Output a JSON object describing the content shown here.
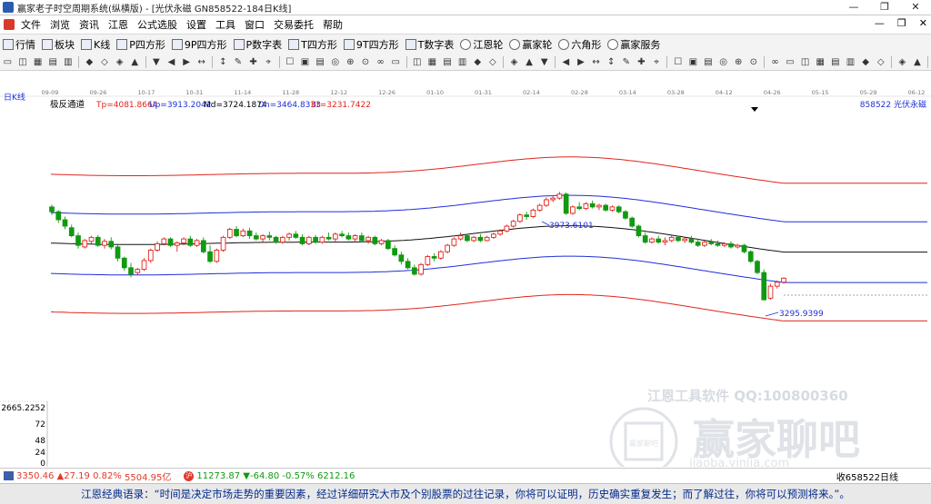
{
  "window": {
    "title": "赢家老子时空周期系统(纵横版) - [光伏永磁  GN858522-184日K线]",
    "controls": [
      "—",
      "❐",
      "✕"
    ]
  },
  "menu": {
    "items": [
      "文件",
      "浏览",
      "资讯",
      "江恩",
      "公式选股",
      "设置",
      "工具",
      "窗口",
      "交易委托",
      "帮助"
    ],
    "right": [
      "—",
      "❐",
      "✕"
    ]
  },
  "toolbar1": {
    "items": [
      {
        "label": "行情",
        "icon": "grid-icon"
      },
      {
        "label": "板块",
        "icon": "grid-icon"
      },
      {
        "label": "K线",
        "icon": "candlestick-icon"
      },
      {
        "label": "P四方形",
        "icon": "square-p-icon"
      },
      {
        "label": "9P四方形",
        "icon": "square-9p-icon"
      },
      {
        "label": "P数字表",
        "icon": "table-p-icon"
      },
      {
        "label": "T四方形",
        "icon": "square-t-icon"
      },
      {
        "label": "9T四方形",
        "icon": "square-9t-icon"
      },
      {
        "label": "T数字表",
        "icon": "table-t-icon"
      },
      {
        "label": "江恩轮",
        "icon": "wheel-icon"
      },
      {
        "label": "赢家轮",
        "icon": "wheel-icon"
      },
      {
        "label": "六角形",
        "icon": "hexagon-icon"
      },
      {
        "label": "赢家服务",
        "icon": "dollar-icon"
      }
    ]
  },
  "toolbar2": {
    "groups": [
      5,
      4,
      4,
      4,
      8,
      6,
      3,
      7,
      6,
      8,
      2
    ]
  },
  "chart": {
    "period_label": "日K线",
    "indicator_name": "极反通道",
    "tp_text": "Tp=4081.8664",
    "up_text": "Up=3913.2042",
    "md_text": "Md=3724.1874",
    "dn_text": "Dn=3464.8333",
    "bt_text": "Bt=3231.7422",
    "symbol_text": "858522  光伏永磁",
    "high_annotation": "3973.6101",
    "low_annotation": "3295.9399",
    "dates": [
      "09-09",
      "09-26",
      "10-17",
      "10-31",
      "11-14",
      "11-28",
      "12-12",
      "12-26",
      "01-10",
      "01-31",
      "02-14",
      "02-28",
      "03-14",
      "03-28",
      "04-12",
      "04-26",
      "05-15",
      "05-29",
      "06-12"
    ],
    "price_label": "2665.2252",
    "volume_labels": [
      "72",
      "48",
      "24",
      "0"
    ]
  },
  "chart_data": {
    "type": "candlestick",
    "title": "光伏永磁 858522 日K线",
    "indicator": "极反通道",
    "price_range": [
      2665.2252,
      4560
    ],
    "x_ticks": [
      "09-09",
      "09-26",
      "10-17",
      "10-31",
      "11-14",
      "11-28",
      "12-12",
      "12-26",
      "01-10",
      "01-31",
      "02-14",
      "02-28",
      "03-14",
      "03-28",
      "04-12",
      "04-26",
      "05-15",
      "05-29",
      "06-12"
    ],
    "channel_last_values": {
      "Tp": 4081.8664,
      "Up": 3913.2042,
      "Md": 3724.1874,
      "Dn": 3464.8333,
      "Bt": 3231.7422
    },
    "annotations": {
      "high": 3973.6101,
      "low": 3295.9399
    },
    "candles": [
      {
        "o": 3880,
        "h": 3895,
        "c": 3850,
        "l": 3830
      },
      {
        "o": 3850,
        "h": 3860,
        "c": 3800,
        "l": 3780
      },
      {
        "o": 3800,
        "h": 3820,
        "c": 3760,
        "l": 3740
      },
      {
        "o": 3750,
        "h": 3770,
        "c": 3700,
        "l": 3690
      },
      {
        "o": 3700,
        "h": 3720,
        "c": 3640,
        "l": 3620
      },
      {
        "o": 3630,
        "h": 3680,
        "c": 3670,
        "l": 3620
      },
      {
        "o": 3665,
        "h": 3700,
        "c": 3690,
        "l": 3650
      },
      {
        "o": 3690,
        "h": 3705,
        "c": 3640,
        "l": 3630
      },
      {
        "o": 3640,
        "h": 3680,
        "c": 3665,
        "l": 3620
      },
      {
        "o": 3665,
        "h": 3690,
        "c": 3630,
        "l": 3615
      },
      {
        "o": 3630,
        "h": 3650,
        "c": 3560,
        "l": 3540
      },
      {
        "o": 3560,
        "h": 3570,
        "c": 3500,
        "l": 3480
      },
      {
        "o": 3500,
        "h": 3530,
        "c": 3460,
        "l": 3440
      },
      {
        "o": 3470,
        "h": 3500,
        "c": 3490,
        "l": 3455
      },
      {
        "o": 3490,
        "h": 3560,
        "c": 3545,
        "l": 3480
      },
      {
        "o": 3545,
        "h": 3620,
        "c": 3610,
        "l": 3530
      },
      {
        "o": 3610,
        "h": 3665,
        "c": 3650,
        "l": 3600
      },
      {
        "o": 3650,
        "h": 3690,
        "c": 3680,
        "l": 3640
      },
      {
        "o": 3680,
        "h": 3690,
        "c": 3640,
        "l": 3630
      },
      {
        "o": 3640,
        "h": 3665,
        "c": 3655,
        "l": 3600
      },
      {
        "o": 3655,
        "h": 3690,
        "c": 3680,
        "l": 3640
      },
      {
        "o": 3680,
        "h": 3700,
        "c": 3640,
        "l": 3630
      },
      {
        "o": 3640,
        "h": 3680,
        "c": 3670,
        "l": 3630
      },
      {
        "o": 3670,
        "h": 3690,
        "c": 3600,
        "l": 3590
      },
      {
        "o": 3600,
        "h": 3640,
        "c": 3540,
        "l": 3530
      },
      {
        "o": 3540,
        "h": 3620,
        "c": 3610,
        "l": 3530
      },
      {
        "o": 3610,
        "h": 3700,
        "c": 3690,
        "l": 3600
      },
      {
        "o": 3690,
        "h": 3750,
        "c": 3740,
        "l": 3680
      },
      {
        "o": 3740,
        "h": 3760,
        "c": 3700,
        "l": 3690
      },
      {
        "o": 3700,
        "h": 3745,
        "c": 3730,
        "l": 3690
      },
      {
        "o": 3730,
        "h": 3750,
        "c": 3700,
        "l": 3680
      },
      {
        "o": 3700,
        "h": 3720,
        "c": 3680,
        "l": 3670
      },
      {
        "o": 3680,
        "h": 3710,
        "c": 3700,
        "l": 3660
      },
      {
        "o": 3700,
        "h": 3725,
        "c": 3690,
        "l": 3670
      },
      {
        "o": 3690,
        "h": 3700,
        "c": 3660,
        "l": 3650
      },
      {
        "o": 3660,
        "h": 3700,
        "c": 3690,
        "l": 3650
      },
      {
        "o": 3690,
        "h": 3720,
        "c": 3710,
        "l": 3670
      },
      {
        "o": 3710,
        "h": 3730,
        "c": 3690,
        "l": 3680
      },
      {
        "o": 3690,
        "h": 3710,
        "c": 3650,
        "l": 3640
      },
      {
        "o": 3650,
        "h": 3700,
        "c": 3690,
        "l": 3640
      },
      {
        "o": 3690,
        "h": 3705,
        "c": 3660,
        "l": 3650
      },
      {
        "o": 3660,
        "h": 3700,
        "c": 3690,
        "l": 3650
      },
      {
        "o": 3690,
        "h": 3720,
        "c": 3680,
        "l": 3670
      },
      {
        "o": 3680,
        "h": 3720,
        "c": 3710,
        "l": 3660
      },
      {
        "o": 3710,
        "h": 3730,
        "c": 3700,
        "l": 3690
      },
      {
        "o": 3700,
        "h": 3720,
        "c": 3680,
        "l": 3670
      },
      {
        "o": 3680,
        "h": 3710,
        "c": 3700,
        "l": 3660
      },
      {
        "o": 3700,
        "h": 3720,
        "c": 3670,
        "l": 3660
      },
      {
        "o": 3670,
        "h": 3700,
        "c": 3690,
        "l": 3650
      },
      {
        "o": 3690,
        "h": 3700,
        "c": 3650,
        "l": 3640
      },
      {
        "o": 3650,
        "h": 3680,
        "c": 3670,
        "l": 3640
      },
      {
        "o": 3670,
        "h": 3680,
        "c": 3620,
        "l": 3610
      },
      {
        "o": 3620,
        "h": 3640,
        "c": 3580,
        "l": 3570
      },
      {
        "o": 3580,
        "h": 3600,
        "c": 3540,
        "l": 3520
      },
      {
        "o": 3540,
        "h": 3560,
        "c": 3500,
        "l": 3490
      },
      {
        "o": 3500,
        "h": 3520,
        "c": 3460,
        "l": 3450
      },
      {
        "o": 3460,
        "h": 3530,
        "c": 3520,
        "l": 3450
      },
      {
        "o": 3520,
        "h": 3580,
        "c": 3570,
        "l": 3510
      },
      {
        "o": 3570,
        "h": 3590,
        "c": 3560,
        "l": 3540
      },
      {
        "o": 3560,
        "h": 3610,
        "c": 3600,
        "l": 3550
      },
      {
        "o": 3600,
        "h": 3650,
        "c": 3640,
        "l": 3590
      },
      {
        "o": 3640,
        "h": 3690,
        "c": 3680,
        "l": 3630
      },
      {
        "o": 3680,
        "h": 3720,
        "c": 3700,
        "l": 3670
      },
      {
        "o": 3700,
        "h": 3710,
        "c": 3670,
        "l": 3660
      },
      {
        "o": 3670,
        "h": 3700,
        "c": 3690,
        "l": 3660
      },
      {
        "o": 3690,
        "h": 3710,
        "c": 3670,
        "l": 3660
      },
      {
        "o": 3670,
        "h": 3700,
        "c": 3690,
        "l": 3665
      },
      {
        "o": 3690,
        "h": 3720,
        "c": 3710,
        "l": 3680
      },
      {
        "o": 3710,
        "h": 3740,
        "c": 3730,
        "l": 3700
      },
      {
        "o": 3730,
        "h": 3770,
        "c": 3760,
        "l": 3720
      },
      {
        "o": 3760,
        "h": 3800,
        "c": 3790,
        "l": 3750
      },
      {
        "o": 3790,
        "h": 3840,
        "c": 3830,
        "l": 3780
      },
      {
        "o": 3830,
        "h": 3850,
        "c": 3820,
        "l": 3800
      },
      {
        "o": 3820,
        "h": 3870,
        "c": 3860,
        "l": 3810
      },
      {
        "o": 3860,
        "h": 3900,
        "c": 3890,
        "l": 3850
      },
      {
        "o": 3890,
        "h": 3940,
        "c": 3925,
        "l": 3880
      },
      {
        "o": 3925,
        "h": 3950,
        "c": 3935,
        "l": 3910
      },
      {
        "o": 3935,
        "h": 3974,
        "c": 3960,
        "l": 3925
      },
      {
        "o": 3960,
        "h": 3970,
        "c": 3840,
        "l": 3830
      },
      {
        "o": 3840,
        "h": 3890,
        "c": 3880,
        "l": 3830
      },
      {
        "o": 3880,
        "h": 3910,
        "c": 3870,
        "l": 3860
      },
      {
        "o": 3870,
        "h": 3910,
        "c": 3900,
        "l": 3860
      },
      {
        "o": 3900,
        "h": 3920,
        "c": 3880,
        "l": 3870
      },
      {
        "o": 3880,
        "h": 3900,
        "c": 3890,
        "l": 3860
      },
      {
        "o": 3890,
        "h": 3900,
        "c": 3860,
        "l": 3850
      },
      {
        "o": 3860,
        "h": 3890,
        "c": 3880,
        "l": 3850
      },
      {
        "o": 3880,
        "h": 3890,
        "c": 3850,
        "l": 3840
      },
      {
        "o": 3850,
        "h": 3860,
        "c": 3810,
        "l": 3800
      },
      {
        "o": 3810,
        "h": 3820,
        "c": 3760,
        "l": 3750
      },
      {
        "o": 3760,
        "h": 3770,
        "c": 3700,
        "l": 3690
      },
      {
        "o": 3700,
        "h": 3720,
        "c": 3660,
        "l": 3650
      },
      {
        "o": 3660,
        "h": 3690,
        "c": 3680,
        "l": 3650
      },
      {
        "o": 3680,
        "h": 3700,
        "c": 3660,
        "l": 3650
      },
      {
        "o": 3660,
        "h": 3690,
        "c": 3670,
        "l": 3640
      },
      {
        "o": 3670,
        "h": 3700,
        "c": 3690,
        "l": 3660
      },
      {
        "o": 3690,
        "h": 3700,
        "c": 3670,
        "l": 3660
      },
      {
        "o": 3670,
        "h": 3690,
        "c": 3680,
        "l": 3655
      },
      {
        "o": 3680,
        "h": 3700,
        "c": 3660,
        "l": 3650
      },
      {
        "o": 3660,
        "h": 3680,
        "c": 3640,
        "l": 3630
      },
      {
        "o": 3640,
        "h": 3670,
        "c": 3660,
        "l": 3630
      },
      {
        "o": 3660,
        "h": 3680,
        "c": 3650,
        "l": 3640
      },
      {
        "o": 3650,
        "h": 3670,
        "c": 3640,
        "l": 3630
      },
      {
        "o": 3640,
        "h": 3660,
        "c": 3650,
        "l": 3630
      },
      {
        "o": 3650,
        "h": 3665,
        "c": 3630,
        "l": 3620
      },
      {
        "o": 3630,
        "h": 3650,
        "c": 3640,
        "l": 3620
      },
      {
        "o": 3640,
        "h": 3650,
        "c": 3600,
        "l": 3590
      },
      {
        "o": 3600,
        "h": 3610,
        "c": 3540,
        "l": 3530
      },
      {
        "o": 3540,
        "h": 3550,
        "c": 3470,
        "l": 3460
      },
      {
        "o": 3470,
        "h": 3490,
        "c": 3300,
        "l": 3296
      },
      {
        "o": 3310,
        "h": 3400,
        "c": 3385,
        "l": 3300
      },
      {
        "o": 3385,
        "h": 3420,
        "c": 3410,
        "l": 3370
      },
      {
        "o": 3410,
        "h": 3440,
        "c": 3435,
        "l": 3400
      }
    ]
  },
  "status_bar": {
    "sh_value": "3350.46",
    "sh_change": "▲27.19",
    "sh_pct": "0.82%",
    "sh_amount": "5504.95亿",
    "sz_value": "11273.87",
    "sz_change": "▼-64.80",
    "sz_pct": "-0.57%",
    "sz_amount": "6212.16",
    "right_text": "收658522日线"
  },
  "quote_bar": {
    "text": "江恩经典语录：“时间是决定市场走势的重要因素，经过详细研究大市及个别股票的过往记录，你将可以证明，历史确实重复发生；而了解过往，你将可以预测将来。”。"
  },
  "watermark": {
    "line1": "江恩工具软件  QQ:100800360",
    "line2": "赢家聊吧",
    "seal": "赢家聊吧",
    "url": "jiaoba.yinjia.com"
  },
  "colors": {
    "band_outer": "#e0241c",
    "band_inner": "#1f2fd8",
    "mid": "#111111",
    "up": "#e0241c",
    "down": "#119911",
    "text_blue": "#1f2fd8",
    "quote": "#002a8a"
  }
}
